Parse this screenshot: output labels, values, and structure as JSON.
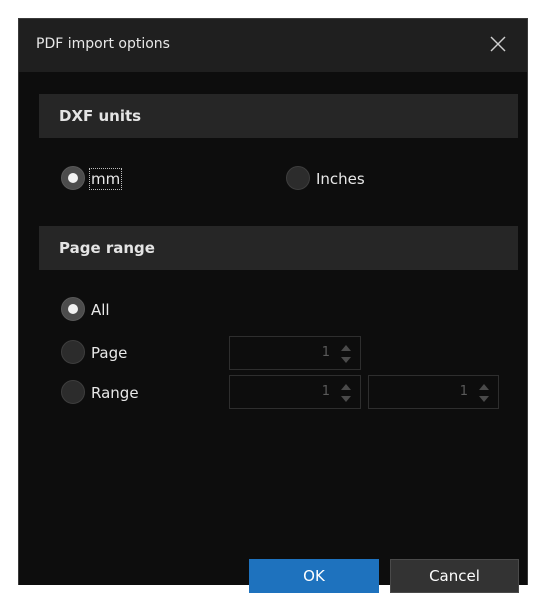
{
  "dialog": {
    "title": "PDF import options"
  },
  "dxf_units": {
    "heading": "DXF units",
    "options": [
      {
        "label": "mm",
        "checked": true
      },
      {
        "label": "Inches",
        "checked": false
      }
    ]
  },
  "page_range": {
    "heading": "Page range",
    "options": [
      {
        "label": "All",
        "checked": true
      },
      {
        "label": "Page",
        "checked": false
      },
      {
        "label": "Range",
        "checked": false
      }
    ],
    "page_value": "1",
    "range_from": "1",
    "range_to": "1"
  },
  "buttons": {
    "ok": "OK",
    "cancel": "Cancel"
  },
  "colors": {
    "accent": "#1e72be",
    "background": "#0d0d0d"
  }
}
